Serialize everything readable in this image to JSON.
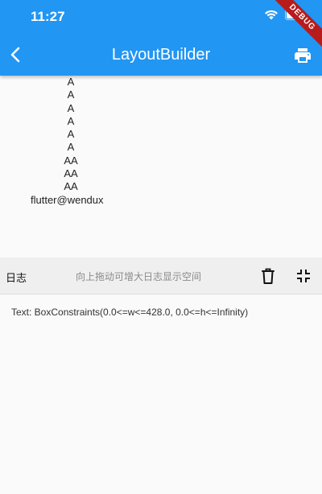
{
  "status_bar": {
    "time": "11:27",
    "debug_banner": "DEBUG"
  },
  "appbar": {
    "title": "LayoutBuilder",
    "back_icon": "back-arrow-icon",
    "action_icon": "print-icon"
  },
  "content": {
    "items": [
      "A",
      "A",
      "A",
      "A",
      "A",
      "A",
      "AA",
      "AA",
      "AA"
    ],
    "author": "flutter@wendux"
  },
  "log_panel": {
    "label": "日志",
    "hint": "向上拖动可增大日志显示空间",
    "delete_icon": "delete-icon",
    "collapse_icon": "collapse-icon",
    "lines": [
      "Text: BoxConstraints(0.0<=w<=428.0, 0.0<=h<=Infinity)"
    ]
  },
  "colors": {
    "primary": "#2196f3",
    "debug": "#b71c1c"
  }
}
